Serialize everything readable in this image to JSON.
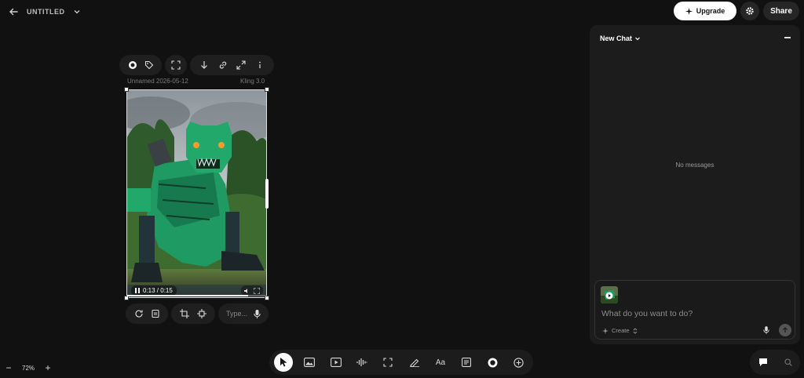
{
  "project": {
    "title": "UNTITLED"
  },
  "header": {
    "upgrade_label": "Upgrade",
    "share_label": "Share"
  },
  "card": {
    "name": "Unnamed 2026-05-12",
    "model": "Kling 3.0",
    "video": {
      "time": "0:13 / 0:15",
      "progress": 0.87
    },
    "prompt_placeholder": "Type..."
  },
  "chat": {
    "title": "New Chat",
    "empty_text": "No messages",
    "input_placeholder": "What do you want to do?",
    "mode_label": "Create"
  },
  "zoom": {
    "level": "72%"
  },
  "dock": {
    "text_tool_label": "Aa"
  },
  "colors": {
    "background": "#111111",
    "panel": "#1c1c1c",
    "accent": "#ffffff",
    "robot_green": "#1f9a63"
  }
}
